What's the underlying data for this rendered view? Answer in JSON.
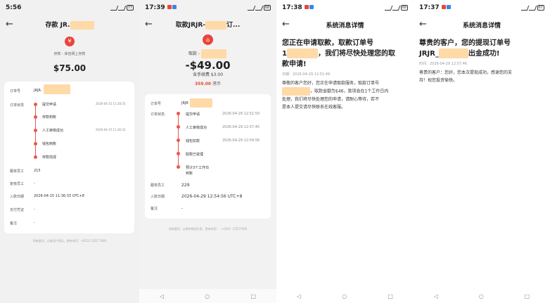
{
  "p1": {
    "time": "5:56",
    "battery": "77",
    "title": "存款 JR.",
    "subtitle": "存款 - 来自网上存款",
    "amount": "$75.00",
    "order_label": "订单号",
    "order_value": "JRJR-",
    "status_label": "订单状态",
    "timeline": [
      {
        "label": "提交申请",
        "time": "2026-04-15 11:28:35"
      },
      {
        "label": "存款到账",
        "time": ""
      },
      {
        "label": "人工审核成功",
        "time": "2026-04-15 11:36:32"
      },
      {
        "label": "钱包到账",
        "time": ""
      },
      {
        "label": "存款完成",
        "time": ""
      }
    ],
    "rows": [
      {
        "label": "跟单员工",
        "value": "215"
      },
      {
        "label": "复核员工",
        "value": "-"
      },
      {
        "label": "入款日期",
        "value": "2026-04-15 11:36:33 UTC+8"
      },
      {
        "label": "支付凭证",
        "value": "-"
      },
      {
        "label": "备注",
        "value": "-"
      }
    ],
    "footer": "如有疑问，以帐现户团队，更有电话：+8522 2355 7666"
  },
  "p2": {
    "time": "17:39",
    "battery": "68",
    "title": "取款JRJR-",
    "title_suffix": "订...",
    "from_label": "取款 - ",
    "amount": "-$49.00",
    "fee": "含手续费 $3.00",
    "hkd_value": "359.00",
    "hkd_unit": "港币",
    "order_label": "订单号",
    "order_value": "JRJR",
    "status_label": "订单状态",
    "timeline": [
      {
        "label": "提交申请",
        "time": "2026-04-29 12:51:50"
      },
      {
        "label": "人工审核成功",
        "time": "2026-04-29 12:57:45"
      },
      {
        "label": "钱包扣款",
        "time": "2026-04-29 12:54:56"
      },
      {
        "label": "取款已受理",
        "time": ""
      },
      {
        "label": "预计3个工作日",
        "time": ""
      }
    ],
    "timeline_extra": "到账",
    "rows": [
      {
        "label": "跟单员工",
        "value": "229"
      },
      {
        "label": "入款日期",
        "value": "2026-04-29 12:54:56 UTC+8"
      },
      {
        "label": "备注",
        "value": "-"
      }
    ],
    "footer": "如有疑问，以帐供销回头条，更有电话：（+852）23557666"
  },
  "p3": {
    "time": "17:38",
    "battery": "68",
    "title": "系统消息详情",
    "heading_l1": "您正在申请取款，取款订单号",
    "heading_l2_pre": "1",
    "heading_l2_post": "，我们将尽快处理您的取",
    "heading_l3": "款申请!",
    "date": "日期：2026-04-29 12:51:49",
    "body_l1": "尊敬的客户您好，您正在申请取款服务，取款订单号",
    "body_l2": "，取款金额为$46，款项会在1个工作日内",
    "body_l3": "处理，我们将尽快处理您的申请，请耐心等待，若不",
    "body_l4": "是本人提交请尽快联系在线客服。"
  },
  "p4": {
    "time": "17:37",
    "battery": "67",
    "title": "系统消息详情",
    "heading_l1": "尊贵的客户，您的提现订单号",
    "heading_l2_pre": "JRJR_",
    "heading_l2_post": "出金成功!",
    "date": "时间：2026-04-29 12:57:46",
    "body_l1": "尊贵的客户：您好，您本次提现成功，感谢您的支",
    "body_l2": "持！祝您投资愉快。"
  },
  "nav": {
    "back": "◁",
    "home": "○",
    "recent": "□"
  }
}
